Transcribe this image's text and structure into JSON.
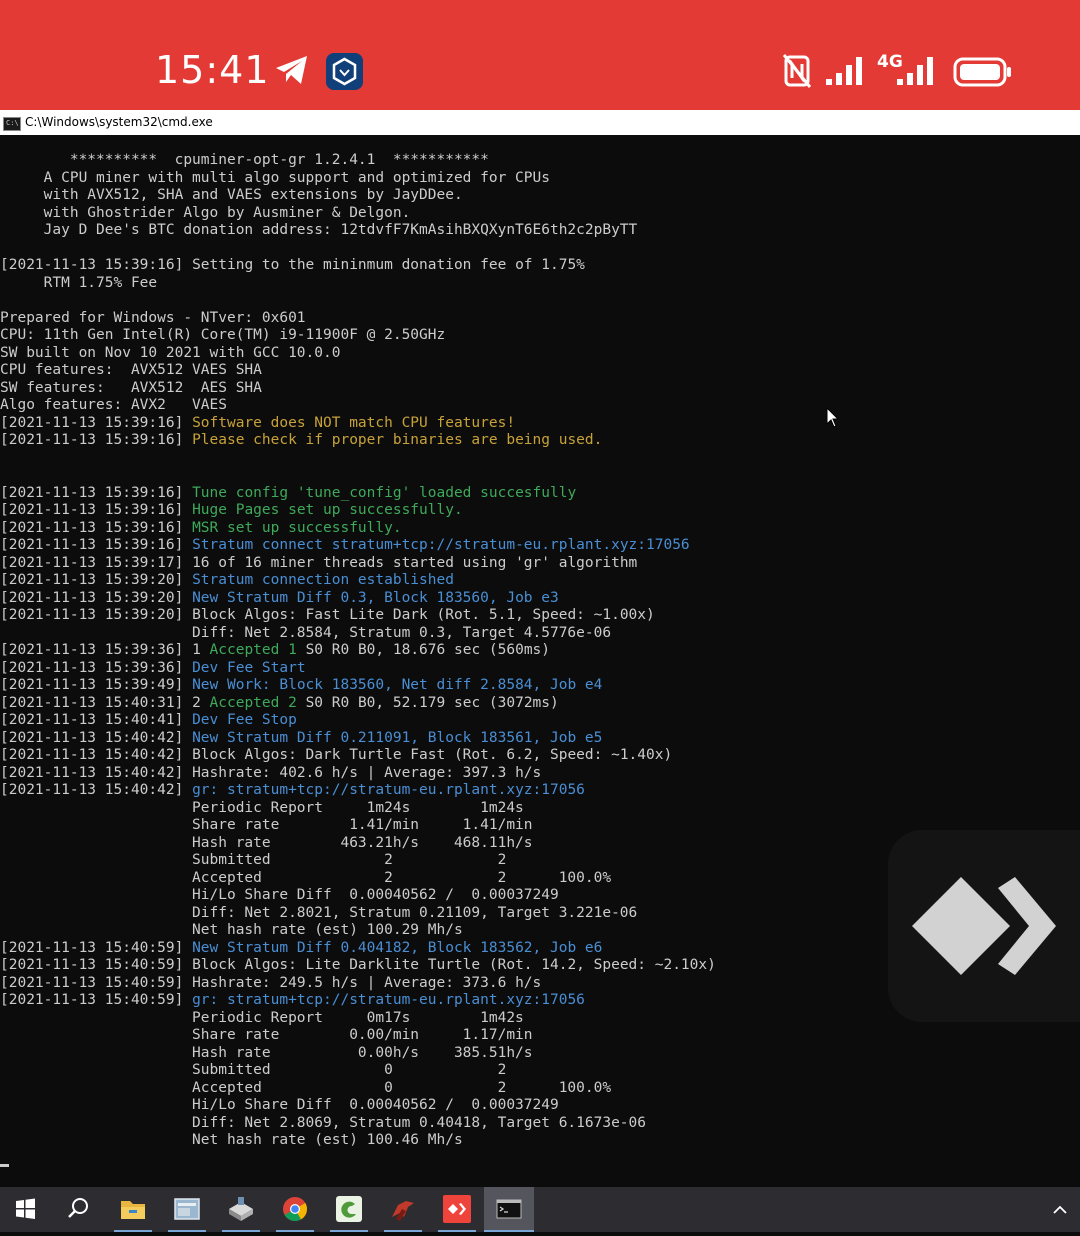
{
  "status_bar": {
    "time": "15:41",
    "network": "4G",
    "icons": [
      "telegram-icon",
      "crypto-com-icon",
      "nfc-off-icon",
      "signal-icon",
      "signal-4g-icon",
      "battery-icon"
    ],
    "background": "#e43a35"
  },
  "window": {
    "title": "C:\\Windows\\system32\\cmd.exe"
  },
  "console": {
    "colors": {
      "white": "#cccccc",
      "yellow": "#c7a23a",
      "green": "#3ea95a",
      "blue": "#4a8ed4"
    },
    "lines": [
      {
        "segs": [
          {
            "t": "        **********  cpuminer-opt-gr 1.2.4.1  ***********",
            "c": "w"
          }
        ]
      },
      {
        "segs": [
          {
            "t": "     A CPU miner with multi algo support and optimized for CPUs",
            "c": "w"
          }
        ]
      },
      {
        "segs": [
          {
            "t": "     with AVX512, SHA and VAES extensions by JayDDee.",
            "c": "w"
          }
        ]
      },
      {
        "segs": [
          {
            "t": "     with Ghostrider Algo by Ausminer & Delgon.",
            "c": "w"
          }
        ]
      },
      {
        "segs": [
          {
            "t": "     Jay D Dee's BTC donation address: 12tdvfF7KmAsihBXQXynT6E6th2c2pByTT",
            "c": "w"
          }
        ]
      },
      {
        "segs": []
      },
      {
        "segs": [
          {
            "t": "[2021-11-13 15:39:16] ",
            "c": "w"
          },
          {
            "t": "Setting to the mininmum donation fee of 1.75%",
            "c": "w"
          }
        ]
      },
      {
        "segs": [
          {
            "t": "     RTM 1.75% Fee",
            "c": "w"
          }
        ]
      },
      {
        "segs": []
      },
      {
        "segs": [
          {
            "t": "Prepared for Windows - NTver: 0x601",
            "c": "w"
          }
        ]
      },
      {
        "segs": [
          {
            "t": "CPU: 11th Gen Intel(R) Core(TM) i9-11900F @ 2.50GHz",
            "c": "w"
          }
        ]
      },
      {
        "segs": [
          {
            "t": "SW built on Nov 10 2021 with GCC 10.0.0",
            "c": "w"
          }
        ]
      },
      {
        "segs": [
          {
            "t": "CPU features:  AVX512 VAES SHA",
            "c": "w"
          }
        ]
      },
      {
        "segs": [
          {
            "t": "SW features:   AVX512  AES SHA",
            "c": "w"
          }
        ]
      },
      {
        "segs": [
          {
            "t": "Algo features: AVX2   VAES",
            "c": "w"
          }
        ]
      },
      {
        "segs": [
          {
            "t": "[2021-11-13 15:39:16] ",
            "c": "w"
          },
          {
            "t": "Software does NOT match CPU features!",
            "c": "y"
          }
        ]
      },
      {
        "segs": [
          {
            "t": "[2021-11-13 15:39:16] ",
            "c": "w"
          },
          {
            "t": "Please check if proper binaries are being used.",
            "c": "y"
          }
        ]
      },
      {
        "segs": []
      },
      {
        "segs": []
      },
      {
        "segs": [
          {
            "t": "[2021-11-13 15:39:16] ",
            "c": "w"
          },
          {
            "t": "Tune config 'tune_config' loaded succesfully",
            "c": "g"
          }
        ]
      },
      {
        "segs": [
          {
            "t": "[2021-11-13 15:39:16] ",
            "c": "w"
          },
          {
            "t": "Huge Pages set up successfully.",
            "c": "g"
          }
        ]
      },
      {
        "segs": [
          {
            "t": "[2021-11-13 15:39:16] ",
            "c": "w"
          },
          {
            "t": "MSR set up successfully.",
            "c": "g"
          }
        ]
      },
      {
        "segs": [
          {
            "t": "[2021-11-13 15:39:16] ",
            "c": "w"
          },
          {
            "t": "Stratum connect stratum+tcp://stratum-eu.rplant.xyz:17056",
            "c": "b"
          }
        ]
      },
      {
        "segs": [
          {
            "t": "[2021-11-13 15:39:17] ",
            "c": "w"
          },
          {
            "t": "16 of 16 miner threads started using 'gr' algorithm",
            "c": "w"
          }
        ]
      },
      {
        "segs": [
          {
            "t": "[2021-11-13 15:39:20] ",
            "c": "w"
          },
          {
            "t": "Stratum connection established",
            "c": "b"
          }
        ]
      },
      {
        "segs": [
          {
            "t": "[2021-11-13 15:39:20] ",
            "c": "w"
          },
          {
            "t": "New Stratum Diff 0.3, Block 183560, Job e3",
            "c": "b"
          }
        ]
      },
      {
        "segs": [
          {
            "t": "[2021-11-13 15:39:20] ",
            "c": "w"
          },
          {
            "t": "Block Algos: Fast Lite Dark (Rot. 5.1, Speed: ~1.00x)",
            "c": "w"
          }
        ]
      },
      {
        "segs": [
          {
            "t": "                      Diff: Net 2.8584, Stratum 0.3, Target 4.5776e-06",
            "c": "w"
          }
        ]
      },
      {
        "segs": [
          {
            "t": "[2021-11-13 15:39:36] ",
            "c": "w"
          },
          {
            "t": "1 ",
            "c": "w"
          },
          {
            "t": "Accepted 1",
            "c": "g"
          },
          {
            "t": " S0 R0 B0, 18.676 sec (560ms)",
            "c": "w"
          }
        ]
      },
      {
        "segs": [
          {
            "t": "[2021-11-13 15:39:36] ",
            "c": "w"
          },
          {
            "t": "Dev Fee Start",
            "c": "b"
          }
        ]
      },
      {
        "segs": [
          {
            "t": "[2021-11-13 15:39:49] ",
            "c": "w"
          },
          {
            "t": "New Work: Block 183560, Net diff 2.8584, Job e4",
            "c": "b"
          }
        ]
      },
      {
        "segs": [
          {
            "t": "[2021-11-13 15:40:31] ",
            "c": "w"
          },
          {
            "t": "2 ",
            "c": "w"
          },
          {
            "t": "Accepted 2",
            "c": "g"
          },
          {
            "t": " S0 R0 B0, 52.179 sec (3072ms)",
            "c": "w"
          }
        ]
      },
      {
        "segs": [
          {
            "t": "[2021-11-13 15:40:41] ",
            "c": "w"
          },
          {
            "t": "Dev Fee Stop",
            "c": "b"
          }
        ]
      },
      {
        "segs": [
          {
            "t": "[2021-11-13 15:40:42] ",
            "c": "w"
          },
          {
            "t": "New Stratum Diff 0.211091, Block 183561, Job e5",
            "c": "b"
          }
        ]
      },
      {
        "segs": [
          {
            "t": "[2021-11-13 15:40:42] ",
            "c": "w"
          },
          {
            "t": "Block Algos: Dark Turtle Fast (Rot. 6.2, Speed: ~1.40x)",
            "c": "w"
          }
        ]
      },
      {
        "segs": [
          {
            "t": "[2021-11-13 15:40:42] ",
            "c": "w"
          },
          {
            "t": "Hashrate: 402.6 h/s | Average: 397.3 h/s",
            "c": "w"
          }
        ]
      },
      {
        "segs": [
          {
            "t": "[2021-11-13 15:40:42] ",
            "c": "w"
          },
          {
            "t": "gr: stratum+tcp://stratum-eu.rplant.xyz:17056",
            "c": "b"
          }
        ]
      },
      {
        "segs": [
          {
            "t": "                      Periodic Report     1m24s        1m24s",
            "c": "w"
          }
        ]
      },
      {
        "segs": [
          {
            "t": "                      Share rate        1.41/min     1.41/min",
            "c": "w"
          }
        ]
      },
      {
        "segs": [
          {
            "t": "                      Hash rate        463.21h/s    468.11h/s",
            "c": "w"
          }
        ]
      },
      {
        "segs": [
          {
            "t": "                      Submitted             2            2",
            "c": "w"
          }
        ]
      },
      {
        "segs": [
          {
            "t": "                      Accepted              2            2      100.0%",
            "c": "w"
          }
        ]
      },
      {
        "segs": [
          {
            "t": "                      Hi/Lo Share Diff  0.00040562 /  0.00037249",
            "c": "w"
          }
        ]
      },
      {
        "segs": [
          {
            "t": "                      Diff: Net 2.8021, Stratum 0.21109, Target 3.221e-06",
            "c": "w"
          }
        ]
      },
      {
        "segs": [
          {
            "t": "                      Net hash rate (est) 100.29 Mh/s",
            "c": "w"
          }
        ]
      },
      {
        "segs": [
          {
            "t": "[2021-11-13 15:40:59] ",
            "c": "w"
          },
          {
            "t": "New Stratum Diff 0.404182, Block 183562, Job e6",
            "c": "b"
          }
        ]
      },
      {
        "segs": [
          {
            "t": "[2021-11-13 15:40:59] ",
            "c": "w"
          },
          {
            "t": "Block Algos: Lite Darklite Turtle (Rot. 14.2, Speed: ~2.10x)",
            "c": "w"
          }
        ]
      },
      {
        "segs": [
          {
            "t": "[2021-11-13 15:40:59] ",
            "c": "w"
          },
          {
            "t": "Hashrate: 249.5 h/s | Average: 373.6 h/s",
            "c": "w"
          }
        ]
      },
      {
        "segs": [
          {
            "t": "[2021-11-13 15:40:59] ",
            "c": "w"
          },
          {
            "t": "gr: stratum+tcp://stratum-eu.rplant.xyz:17056",
            "c": "b"
          }
        ]
      },
      {
        "segs": [
          {
            "t": "                      Periodic Report     0m17s        1m42s",
            "c": "w"
          }
        ]
      },
      {
        "segs": [
          {
            "t": "                      Share rate        0.00/min     1.17/min",
            "c": "w"
          }
        ]
      },
      {
        "segs": [
          {
            "t": "                      Hash rate          0.00h/s    385.51h/s",
            "c": "w"
          }
        ]
      },
      {
        "segs": [
          {
            "t": "                      Submitted             0            2",
            "c": "w"
          }
        ]
      },
      {
        "segs": [
          {
            "t": "                      Accepted              0            2      100.0%",
            "c": "w"
          }
        ]
      },
      {
        "segs": [
          {
            "t": "                      Hi/Lo Share Diff  0.00040562 /  0.00037249",
            "c": "w"
          }
        ]
      },
      {
        "segs": [
          {
            "t": "                      Diff: Net 2.8069, Stratum 0.40418, Target 6.1673e-06",
            "c": "w"
          }
        ]
      },
      {
        "segs": [
          {
            "t": "                      Net hash rate (est) 100.46 Mh/s",
            "c": "w"
          }
        ]
      }
    ]
  },
  "overlay": {
    "name": "anydesk",
    "icon": "anydesk-logo-icon"
  },
  "taskbar": {
    "items": [
      {
        "name": "start",
        "icon": "windows-logo-icon"
      },
      {
        "name": "search",
        "icon": "search-icon"
      },
      {
        "name": "file-explorer",
        "icon": "folder-icon"
      },
      {
        "name": "app-window",
        "icon": "window-app-icon"
      },
      {
        "name": "installer",
        "icon": "installer-icon"
      },
      {
        "name": "chrome",
        "icon": "chrome-icon"
      },
      {
        "name": "edge-app",
        "icon": "green-e-icon"
      },
      {
        "name": "app-red-figure",
        "icon": "figure-icon"
      },
      {
        "name": "anydesk",
        "icon": "anydesk-icon"
      },
      {
        "name": "cmd",
        "icon": "cmd-icon"
      }
    ],
    "tray_icon": "chevron-up-icon"
  }
}
